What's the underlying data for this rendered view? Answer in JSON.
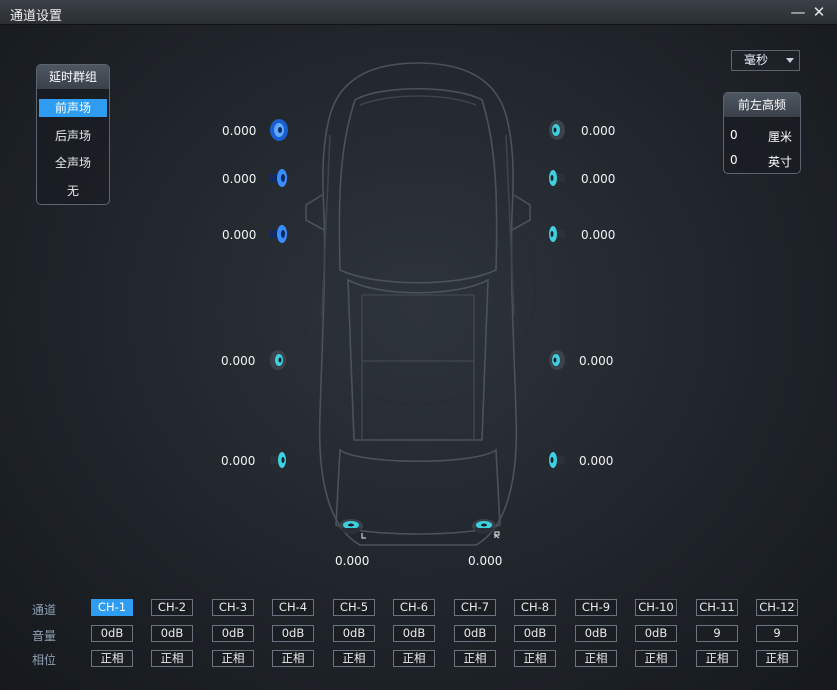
{
  "window": {
    "title": "通道设置",
    "minimize_glyph": "—",
    "close_glyph": "✕"
  },
  "delay_group": {
    "title": "延时群组",
    "items": [
      "前声场",
      "后声场",
      "全声场",
      "无"
    ],
    "selected": 0
  },
  "unit_select": {
    "value": "毫秒"
  },
  "crossover": {
    "title": "前左高频",
    "rows": [
      {
        "value": "0",
        "unit": "厘米"
      },
      {
        "value": "0",
        "unit": "英寸"
      }
    ]
  },
  "delays": {
    "left_tweeter": "0.000",
    "left_mid": "0.000",
    "left_woofer": "0.000",
    "left_rear_front": "0.000",
    "left_rear": "0.000",
    "right_tweeter": "0.000",
    "right_mid": "0.000",
    "right_woofer": "0.000",
    "right_rear_front": "0.000",
    "right_rear": "0.000",
    "sub_left": "0.000",
    "sub_right": "0.000"
  },
  "channels": {
    "row_labels": {
      "channel": "通道",
      "volume": "音量",
      "phase": "相位"
    },
    "selected": 0,
    "items": [
      {
        "name": "CH-1",
        "volume": "0dB",
        "phase": "正相"
      },
      {
        "name": "CH-2",
        "volume": "0dB",
        "phase": "正相"
      },
      {
        "name": "CH-3",
        "volume": "0dB",
        "phase": "正相"
      },
      {
        "name": "CH-4",
        "volume": "0dB",
        "phase": "正相"
      },
      {
        "name": "CH-5",
        "volume": "0dB",
        "phase": "正相"
      },
      {
        "name": "CH-6",
        "volume": "0dB",
        "phase": "正相"
      },
      {
        "name": "CH-7",
        "volume": "0dB",
        "phase": "正相"
      },
      {
        "name": "CH-8",
        "volume": "0dB",
        "phase": "正相"
      },
      {
        "name": "CH-9",
        "volume": "0dB",
        "phase": "正相"
      },
      {
        "name": "CH-10",
        "volume": "0dB",
        "phase": "正相"
      },
      {
        "name": "CH-11",
        "volume": "9",
        "phase": "正相"
      },
      {
        "name": "CH-12",
        "volume": "9",
        "phase": "正相"
      }
    ]
  },
  "colors": {
    "accent": "#2e9cf0",
    "speaker_active": "#3a8cff",
    "speaker_idle": "#3fd0e0"
  }
}
